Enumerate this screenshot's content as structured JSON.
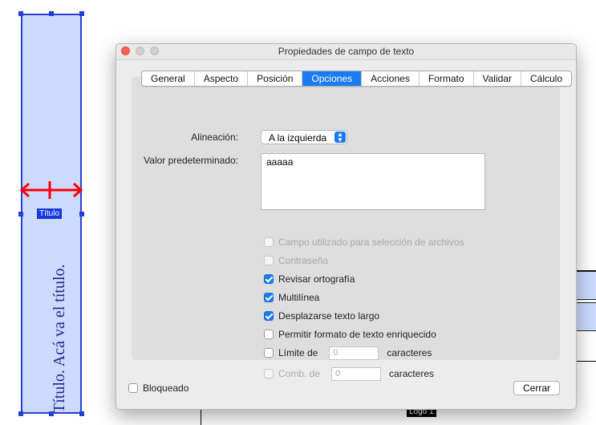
{
  "canvas": {
    "field_tag": "Título",
    "field_text": "Título. Acá va el título.",
    "logo_tag": "Logo 1"
  },
  "dialog": {
    "title": "Propiedades de campo de texto",
    "tabs": [
      {
        "label": "General",
        "active": false
      },
      {
        "label": "Aspecto",
        "active": false
      },
      {
        "label": "Posición",
        "active": false
      },
      {
        "label": "Opciones",
        "active": true
      },
      {
        "label": "Acciones",
        "active": false
      },
      {
        "label": "Formato",
        "active": false
      },
      {
        "label": "Validar",
        "active": false
      },
      {
        "label": "Cálculo",
        "active": false
      }
    ],
    "alignment": {
      "label": "Alineación:",
      "value": "A la izquierda"
    },
    "default_value": {
      "label": "Valor predeterminado:",
      "value": "aaaaa"
    },
    "options": {
      "file_select": {
        "label": "Campo utilizado para selección de archivos",
        "checked": false,
        "enabled": false
      },
      "password": {
        "label": "Contraseña",
        "checked": false,
        "enabled": false
      },
      "spell_check": {
        "label": "Revisar ortografía",
        "checked": true,
        "enabled": true
      },
      "multiline": {
        "label": "Multilínea",
        "checked": true,
        "enabled": true
      },
      "scroll_long": {
        "label": "Desplazarse texto largo",
        "checked": true,
        "enabled": true
      },
      "rich_text": {
        "label": "Permitir formato de texto enriquecido",
        "checked": false,
        "enabled": true
      },
      "limit": {
        "label": "Límite de",
        "value": "0",
        "suffix": "caracteres",
        "checked": false,
        "enabled": true
      },
      "comb": {
        "label": "Comb. de",
        "value": "0",
        "suffix": "caracteres",
        "checked": false,
        "enabled": false
      }
    },
    "locked": {
      "label": "Bloqueado",
      "checked": false
    },
    "close_button": "Cerrar"
  },
  "colors": {
    "accent": "#1a7cf2",
    "field_fill": "#ccdafd",
    "field_border": "#2a3fd9",
    "resize_arrow": "#ff0000"
  }
}
